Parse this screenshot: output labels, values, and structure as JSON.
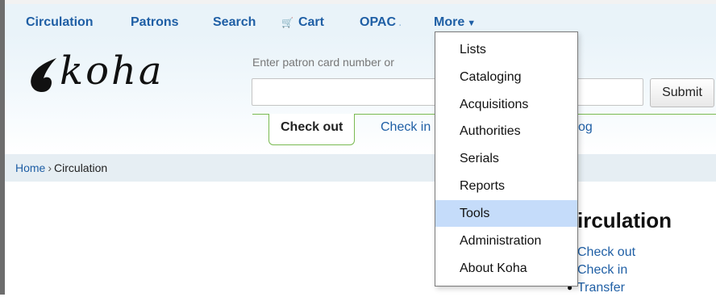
{
  "nav": {
    "items": [
      {
        "label": "Circulation"
      },
      {
        "label": "Patrons"
      },
      {
        "label": "Search"
      },
      {
        "label": "Cart"
      },
      {
        "label": "OPAC"
      },
      {
        "label": "More"
      }
    ],
    "cart_icon": "cart-icon",
    "dropdown_icon": "caret-down-icon"
  },
  "logo": {
    "text": "koha"
  },
  "search": {
    "hint": "Enter patron card number or",
    "value": "",
    "submit_label": "Submit"
  },
  "tabs": [
    {
      "label": "Check out",
      "active": true
    },
    {
      "label": "Check in",
      "active": false
    },
    {
      "label": "og",
      "active": false
    }
  ],
  "breadcrumb": {
    "home": "Home",
    "separator": "›",
    "current": "Circulation"
  },
  "main": {
    "heading": "irculation",
    "links": [
      "Check out",
      "Check in",
      "Transfer"
    ]
  },
  "more_menu": {
    "items": [
      "Lists",
      "Cataloging",
      "Acquisitions",
      "Authorities",
      "Serials",
      "Reports",
      "Tools",
      "Administration",
      "About Koha"
    ],
    "highlighted": "Tools"
  },
  "colors": {
    "link": "#1f5fa5",
    "tab_border": "#7aba52",
    "highlight": "#c5dcfa",
    "header_bg": "#e9f3f9"
  }
}
